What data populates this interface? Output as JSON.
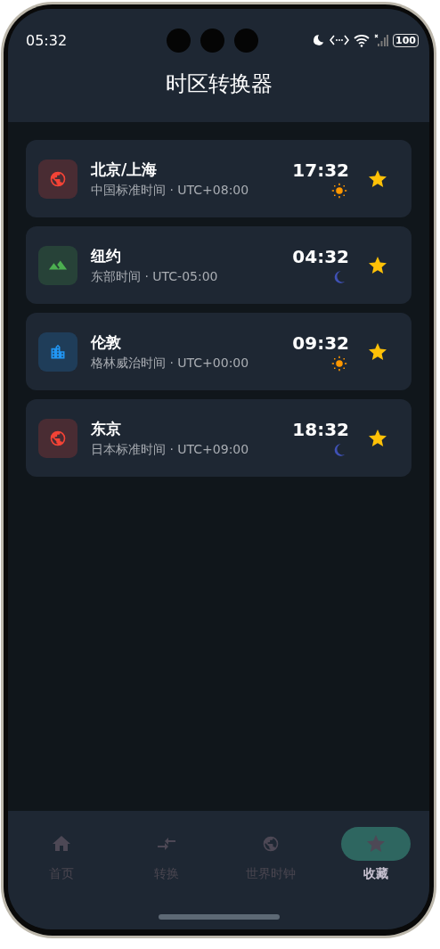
{
  "status_bar": {
    "time": "05:32",
    "battery": "100"
  },
  "header": {
    "title": "时区转换器"
  },
  "cities": [
    {
      "name": "北京/上海",
      "subtitle": "中国标准时间 · UTC+08:00",
      "time": "17:32",
      "kind": "globe",
      "color": "#f44336",
      "daytime": true,
      "favorite": true
    },
    {
      "name": "纽约",
      "subtitle": "东部时间 · UTC-05:00",
      "time": "04:32",
      "kind": "mountain",
      "color": "#4caf50",
      "daytime": false,
      "favorite": true
    },
    {
      "name": "伦敦",
      "subtitle": "格林威治时间 · UTC+00:00",
      "time": "09:32",
      "kind": "city",
      "color": "#2196f3",
      "daytime": true,
      "favorite": true
    },
    {
      "name": "东京",
      "subtitle": "日本标准时间 · UTC+09:00",
      "time": "18:32",
      "kind": "globe",
      "color": "#f44336",
      "daytime": false,
      "favorite": true
    }
  ],
  "nav": [
    {
      "label": "首页",
      "kind": "home",
      "selected": false
    },
    {
      "label": "转换",
      "kind": "convert",
      "selected": false
    },
    {
      "label": "世界时钟",
      "kind": "globe",
      "selected": false
    },
    {
      "label": "收藏",
      "kind": "star",
      "selected": true
    }
  ]
}
